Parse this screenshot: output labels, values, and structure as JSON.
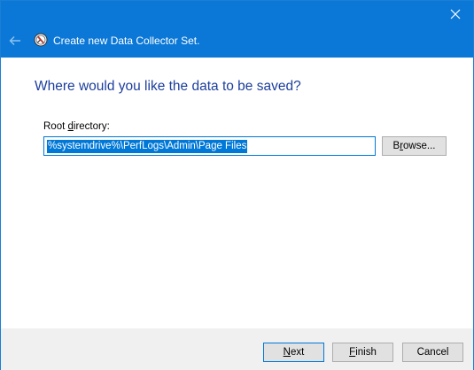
{
  "window": {
    "title": "Create new Data Collector Set.",
    "accent_color": "#0b78d7"
  },
  "icons": {
    "close": "close-icon",
    "back": "back-arrow-icon",
    "app": "data-collector-set-icon"
  },
  "main": {
    "heading": "Where would you like the data to be saved?",
    "root_label_pre": "Root ",
    "root_label_accel": "d",
    "root_label_post": "irectory:",
    "root_directory_value": "%systemdrive%\\PerfLogs\\Admin\\Page Files",
    "browse_pre": "B",
    "browse_accel": "r",
    "browse_post": "owse..."
  },
  "footer": {
    "next_accel": "N",
    "next_post": "ext",
    "finish_accel": "F",
    "finish_post": "inish",
    "cancel_label": "Cancel"
  }
}
